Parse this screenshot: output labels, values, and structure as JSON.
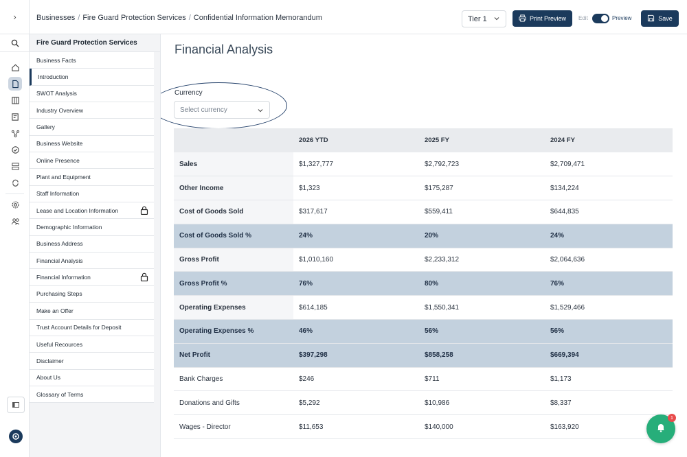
{
  "breadcrumbs": [
    "Businesses",
    "Fire Guard Protection Services",
    "Confidential Information Memorandum"
  ],
  "toolbar": {
    "tier_value": "Tier 1",
    "print_label": "Print Preview",
    "edit_label": "Edit",
    "preview_label": "Preview",
    "save_label": "Save"
  },
  "sections": {
    "title": "Fire Guard Protection Services",
    "items": [
      {
        "label": "Business Facts"
      },
      {
        "label": "Introduction"
      },
      {
        "label": "SWOT Analysis"
      },
      {
        "label": "Industry Overview"
      },
      {
        "label": "Gallery"
      },
      {
        "label": "Business Website"
      },
      {
        "label": "Online Presence"
      },
      {
        "label": "Plant and Equipment"
      },
      {
        "label": "Staff Information"
      },
      {
        "label": "Lease and Location Information"
      },
      {
        "label": "Demographic Information"
      },
      {
        "label": "Business Address"
      },
      {
        "label": "Financial Analysis"
      },
      {
        "label": "Financial Information"
      },
      {
        "label": "Purchasing Steps"
      },
      {
        "label": "Make an Offer"
      },
      {
        "label": "Trust Account Details for Deposit"
      },
      {
        "label": "Useful Recources"
      },
      {
        "label": "Disclaimer"
      },
      {
        "label": "About Us"
      },
      {
        "label": "Glossary of Terms"
      }
    ]
  },
  "main": {
    "title": "Financial Analysis",
    "currency_label": "Currency",
    "currency_placeholder": "Select currency",
    "table": {
      "headers": [
        "",
        "2026 YTD",
        "2025 FY",
        "2024 FY"
      ],
      "rows": [
        {
          "label": "Sales",
          "values": [
            "$1,327,777",
            "$2,792,723",
            "$2,709,471"
          ]
        },
        {
          "label": "Other Income",
          "values": [
            "$1,323",
            "$175,287",
            "$134,224"
          ]
        },
        {
          "label": "Cost of Goods Sold",
          "values": [
            "$317,617",
            "$559,411",
            "$644,835"
          ]
        },
        {
          "label": "Cost of Goods Sold %",
          "values": [
            "24%",
            "20%",
            "24%"
          ]
        },
        {
          "label": "Gross Profit",
          "values": [
            "$1,010,160",
            "$2,233,312",
            "$2,064,636"
          ]
        },
        {
          "label": "Gross Profit %",
          "values": [
            "76%",
            "80%",
            "76%"
          ]
        },
        {
          "label": "Operating Expenses",
          "values": [
            "$614,185",
            "$1,550,341",
            "$1,529,466"
          ]
        },
        {
          "label": "Operating Expenses %",
          "values": [
            "46%",
            "56%",
            "56%"
          ]
        },
        {
          "label": "Net Profit",
          "values": [
            "$397,298",
            "$858,258",
            "$669,394"
          ]
        },
        {
          "label": "Bank Charges",
          "values": [
            "$246",
            "$711",
            "$1,173"
          ]
        },
        {
          "label": "Donations and Gifts",
          "values": [
            "$5,292",
            "$10,986",
            "$8,337"
          ]
        },
        {
          "label": "Wages - Director",
          "values": [
            "$11,653",
            "$140,000",
            "$163,920"
          ]
        }
      ]
    }
  },
  "notifications": {
    "count": "1"
  },
  "colors": {
    "accent": "#1b3a5c",
    "highlight_row": "#c3d1de",
    "fab": "#27ae7a"
  }
}
